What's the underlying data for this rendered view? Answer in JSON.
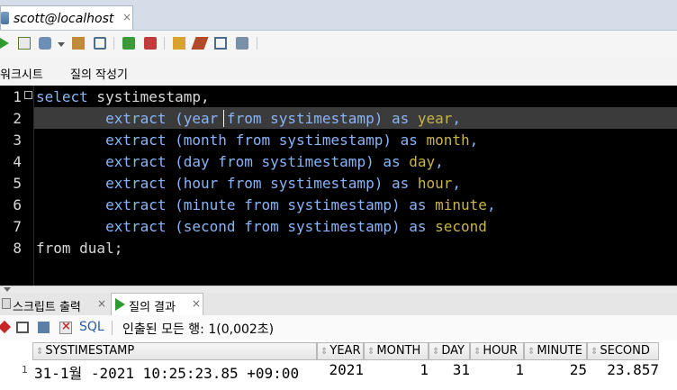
{
  "connection_tab": {
    "label": "scott@localhost",
    "close": "×"
  },
  "subtabs": {
    "worksheet": "워크시트",
    "query_builder": "질의 작성기"
  },
  "editor": {
    "line_numbers": [
      "1",
      "2",
      "3",
      "4",
      "5",
      "6",
      "7",
      "8"
    ],
    "line1": {
      "kw": "select",
      "rest": " systimestamp,"
    },
    "line2": {
      "indent": "        ",
      "fn": "extract",
      "p1": " (year",
      "from": " from",
      "p2": " systimestamp)",
      "as": " as",
      "alias": " year",
      "tail": ","
    },
    "line3": {
      "indent": "        ",
      "fn": "extract",
      "p1": " (month",
      "from": " from",
      "p2": " systimestamp)",
      "as": " as",
      "alias": " month",
      "tail": ","
    },
    "line4": {
      "indent": "        ",
      "fn": "extract",
      "p1": " (day",
      "from": " from",
      "p2": " systimestamp)",
      "as": " as",
      "alias": " day",
      "tail": ","
    },
    "line5": {
      "indent": "        ",
      "fn": "extract",
      "p1": " (hour",
      "from": " from",
      "p2": " systimestamp)",
      "as": " as",
      "alias": " hour",
      "tail": ","
    },
    "line6": {
      "indent": "        ",
      "fn": "extract",
      "p1": " (minute",
      "from": " from",
      "p2": " systimestamp)",
      "as": " as",
      "alias": " minute",
      "tail": ","
    },
    "line7": {
      "indent": "        ",
      "fn": "extract",
      "p1": " (second",
      "from": " from",
      "p2": " systimestamp)",
      "as": " as",
      "alias": " second",
      "tail": ""
    },
    "line8": {
      "kw": "from",
      "rest": " dual;"
    }
  },
  "bottom_tabs": {
    "script_output": "스크립트 출력",
    "query_result": "질의 결과",
    "close": "×"
  },
  "results_toolbar": {
    "sql": "SQL",
    "status": "인출된 모든 행: 1(0,002초)"
  },
  "grid": {
    "headers": [
      "SYSTIMESTAMP",
      "YEAR",
      "MONTH",
      "DAY",
      "HOUR",
      "MINUTE",
      "SECOND"
    ],
    "row_number": "1",
    "row": [
      "31-1월 -2021 10:25:23.85 +09:00",
      "2021",
      "1",
      "31",
      "1",
      "25",
      "23.857"
    ]
  },
  "colors": {
    "editor_bg": "#000000",
    "keyword": "#8ab4f8",
    "alias": "#c8b44a",
    "current_line": "#3b3b3b"
  }
}
